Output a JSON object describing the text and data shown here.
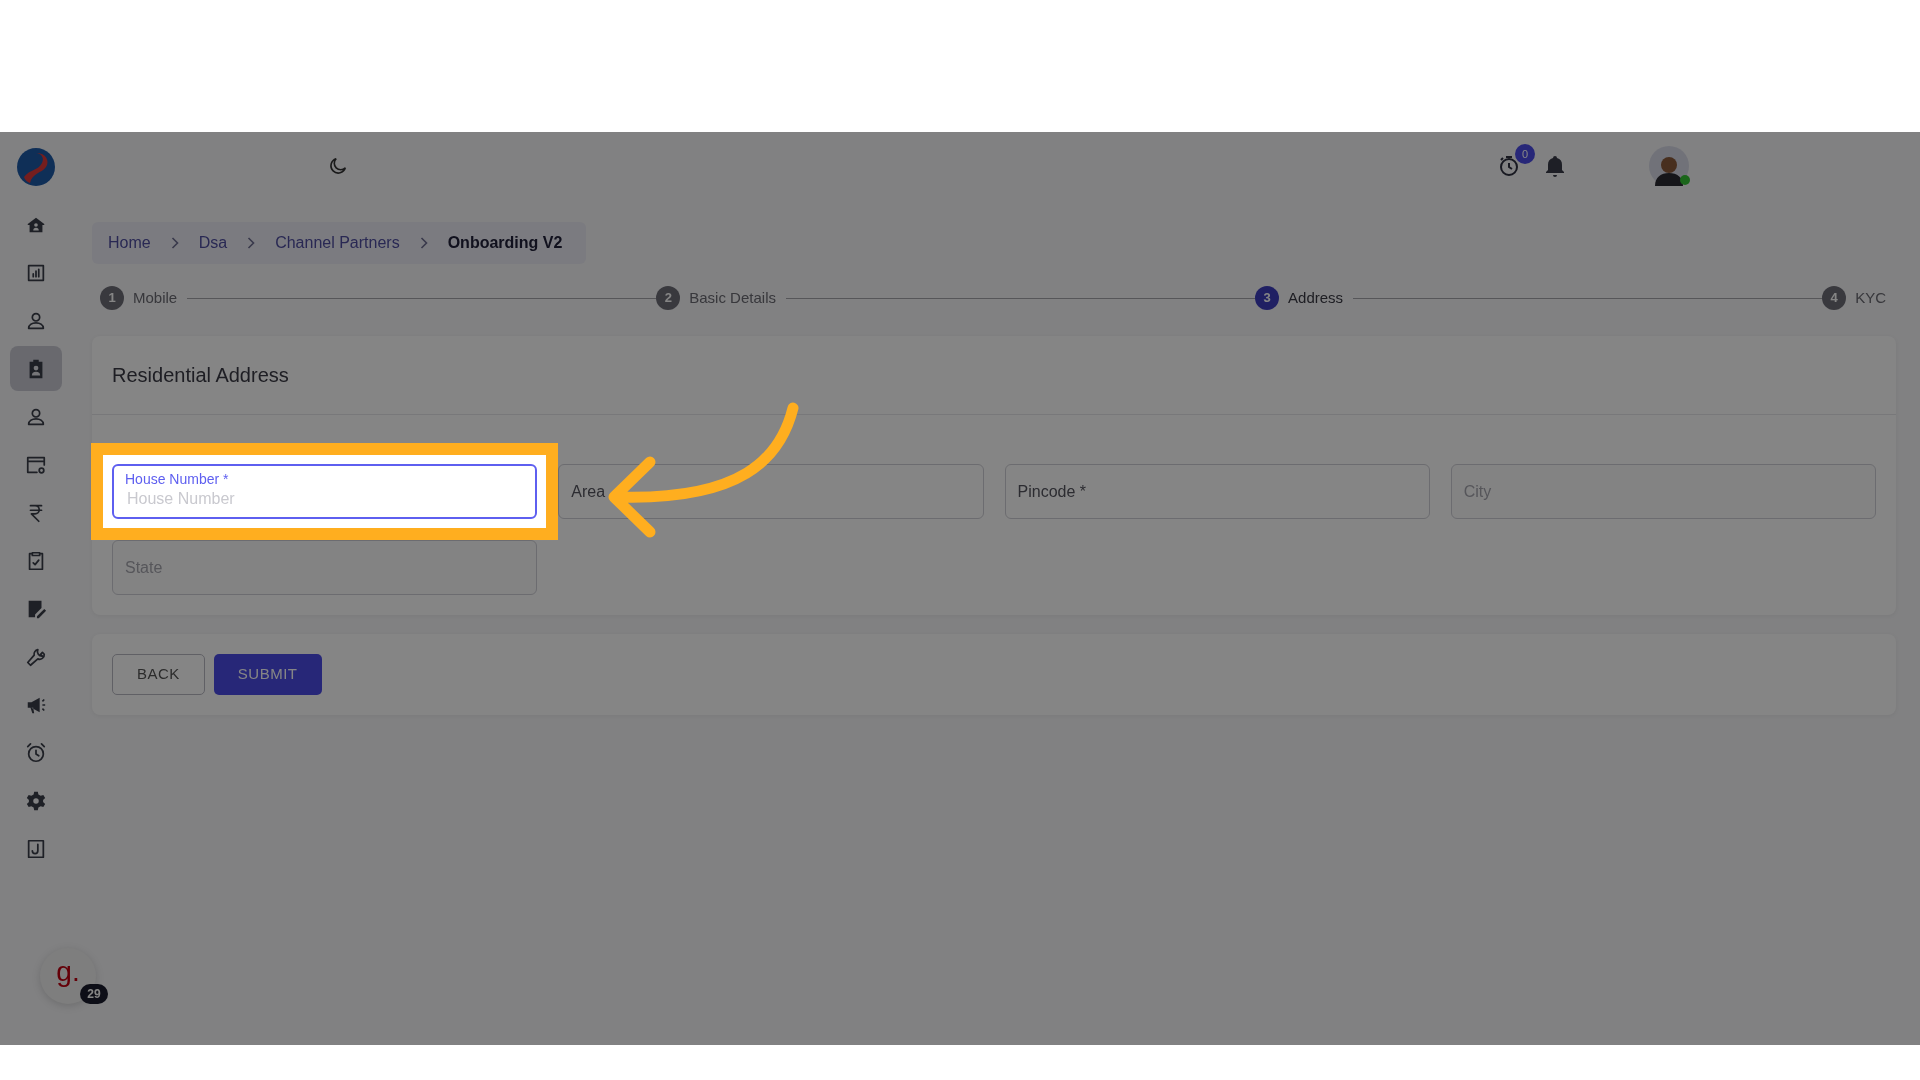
{
  "sidebar": {
    "items": [
      {
        "selected": false
      },
      {
        "selected": false
      },
      {
        "selected": false
      },
      {
        "selected": true
      },
      {
        "selected": false
      },
      {
        "selected": false
      },
      {
        "selected": false
      },
      {
        "selected": false
      },
      {
        "selected": false
      },
      {
        "selected": false
      },
      {
        "selected": false
      },
      {
        "selected": false
      },
      {
        "selected": false
      },
      {
        "selected": false
      }
    ]
  },
  "topbar": {
    "timer_badge": "0",
    "user": {
      "online": true
    }
  },
  "breadcrumb": [
    {
      "label": "Home",
      "current": false
    },
    {
      "label": "Dsa",
      "current": false
    },
    {
      "label": "Channel Partners",
      "current": false
    },
    {
      "label": "Onboarding V2",
      "current": true
    }
  ],
  "steps": [
    {
      "number": "1",
      "label": "Mobile",
      "selected": false
    },
    {
      "number": "2",
      "label": "Basic Details",
      "selected": false
    },
    {
      "number": "3",
      "label": "Address",
      "selected": true
    },
    {
      "number": "4",
      "label": "KYC",
      "selected": false
    }
  ],
  "form": {
    "title": "Residential Address",
    "fields": [
      {
        "label": "House Number *",
        "placeholder": "House Number",
        "focused": true,
        "disabled": false
      },
      {
        "label": "Area",
        "focused": false,
        "disabled": false
      },
      {
        "label": "Pincode *",
        "focused": false,
        "disabled": false
      },
      {
        "label": "City",
        "focused": false,
        "disabled": true
      },
      {
        "label": "State",
        "focused": false,
        "disabled": true
      }
    ],
    "buttons": [
      {
        "label": "BACK",
        "kind": "outline"
      },
      {
        "label": "SUBMIT",
        "kind": "primary"
      }
    ]
  },
  "help_button": {
    "label": "g.",
    "badge": "29"
  }
}
